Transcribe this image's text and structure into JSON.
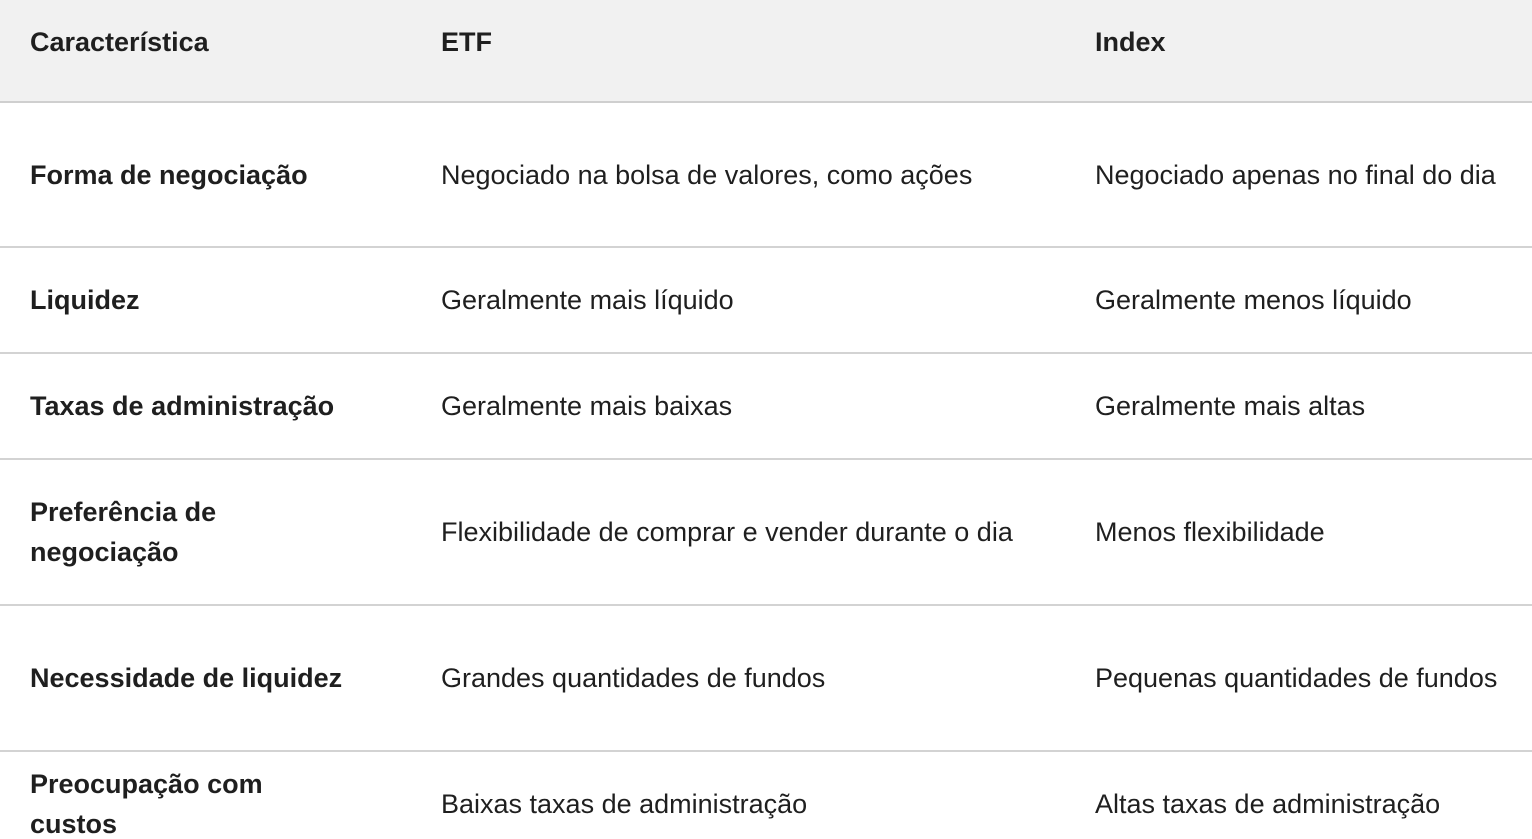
{
  "table": {
    "headers": [
      "Característica",
      "ETF",
      "Index"
    ],
    "rows": [
      [
        "Forma de negociação",
        "Negociado na bolsa de valores, como ações",
        "Negociado apenas no final do dia"
      ],
      [
        "Liquidez",
        "Geralmente mais líquido",
        "Geralmente menos líquido"
      ],
      [
        "Taxas de administração",
        "Geralmente mais baixas",
        "Geralmente mais altas"
      ],
      [
        "Preferência de negociação",
        "Flexibilidade de comprar e vender durante o dia",
        "Menos flexibilidade"
      ],
      [
        "Necessidade de liquidez",
        "Grandes quantidades de fundos",
        "Pequenas quantidades de fundos"
      ],
      [
        "Preocupação com custos",
        "Baixas taxas de administração",
        "Altas taxas de administração"
      ]
    ]
  },
  "colors": {
    "header_bg": "#f1f1f1",
    "text": "#1f1f1f",
    "divider": "#d3d3d3"
  }
}
